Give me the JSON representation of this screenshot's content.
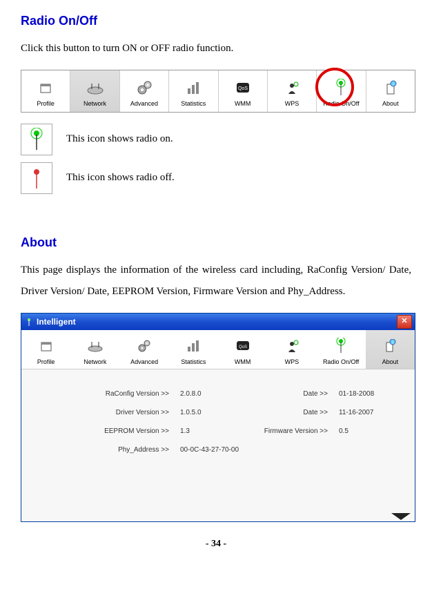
{
  "section1": {
    "heading": "Radio On/Off",
    "desc": "Click this button to turn ON or OFF radio function.",
    "radio_on_text": "This icon shows radio on.",
    "radio_off_text": "This icon shows radio off."
  },
  "section2": {
    "heading": "About",
    "desc": "This page displays the information of the wireless card including, RaConfig Version/ Date, Driver Version/ Date, EEPROM Version, Firmware Version and Phy_Address."
  },
  "toolbar": {
    "items": [
      {
        "label": "Profile"
      },
      {
        "label": "Network"
      },
      {
        "label": "Advanced"
      },
      {
        "label": "Statistics"
      },
      {
        "label": "WMM"
      },
      {
        "label": "WPS"
      },
      {
        "label": "Radio On/Off"
      },
      {
        "label": "About"
      }
    ]
  },
  "window": {
    "title": "Intelligent",
    "fields": {
      "raconfig_label": "RaConfig Version >>",
      "raconfig_value": "2.0.8.0",
      "raconfig_date_label": "Date >>",
      "raconfig_date_value": "01-18-2008",
      "driver_label": "Driver Version >>",
      "driver_value": "1.0.5.0",
      "driver_date_label": "Date >>",
      "driver_date_value": "11-16-2007",
      "eeprom_label": "EEPROM Version >>",
      "eeprom_value": "1.3",
      "firmware_label": "Firmware Version >>",
      "firmware_value": "0.5",
      "phy_label": "Phy_Address >>",
      "phy_value": "00-0C-43-27-70-00"
    }
  },
  "page_number": "- 34 -"
}
